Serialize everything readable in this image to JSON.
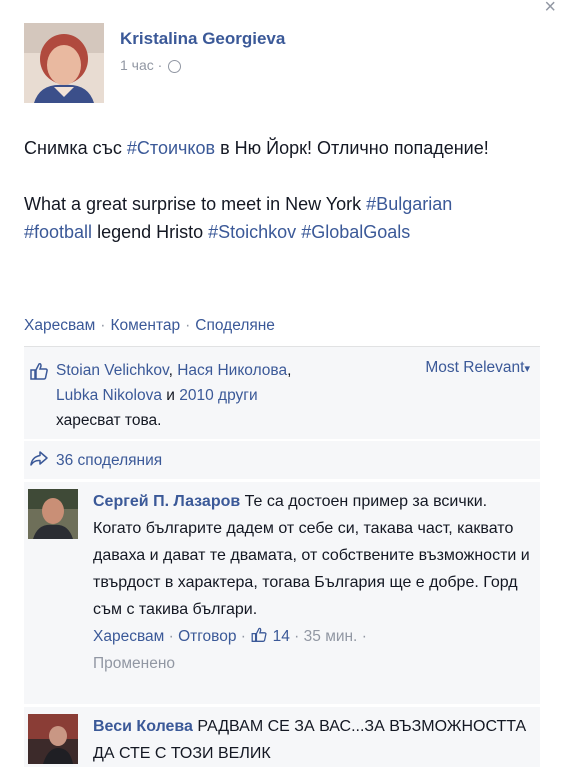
{
  "close_glyph": "×",
  "post": {
    "author": "Kristalina Georgieva",
    "time": "1 час",
    "time_sep": "·",
    "text_bg_prefix": "Снимка със ",
    "text_bg_tag": "#Стоичков",
    "text_bg_suffix": " в Ню Йорк! Отлично попадение!",
    "text_en_prefix": "What a great surprise to meet in New York ",
    "text_en_tag1": "#Bulgarian",
    "text_en_tag2": "#football",
    "text_en_mid": " legend Hristo ",
    "text_en_tag3": "#Stoichkov",
    "text_en_space": " ",
    "text_en_tag4": "#GlobalGoals"
  },
  "actions": {
    "like": "Харесвам",
    "comment": "Коментар",
    "share": "Споделяне",
    "sep": "·"
  },
  "likes": {
    "name1": "Stoian Velichkov",
    "comma": ", ",
    "name2": "Нася Николова",
    "comma2": ",",
    "name3": "Lubka Nikolova",
    "and": " и ",
    "others": "2010 други",
    "suffix": "харесват това.",
    "sort_label": "Most Relevant",
    "sort_arrow": "▾"
  },
  "shares": {
    "label": "36 споделяния"
  },
  "comments": [
    {
      "author": "Сергей П. Лазаров",
      "text": " Те са достоен пример за всички. Когато българите дадем от себе си, такава част, каквато даваха и дават те двамата, от собствените възможности и твърдост в характера, тогава България ще е добре. Горд съм с такива българи.",
      "like": "Харесвам",
      "reply": "Отговор",
      "like_count": "14",
      "time": "35 мин.",
      "sep": "·",
      "edited": "Променено"
    },
    {
      "author": "Веси Колева",
      "text": " РАДВАМ СЕ ЗА ВАС...ЗА ВЪЗМОЖНОСТТА ДА СТЕ С ТОЗИ ВЕЛИК"
    }
  ],
  "colors": {
    "link": "#3b5998",
    "ufi_bg": "#f6f7f9",
    "muted": "#9197a3"
  }
}
